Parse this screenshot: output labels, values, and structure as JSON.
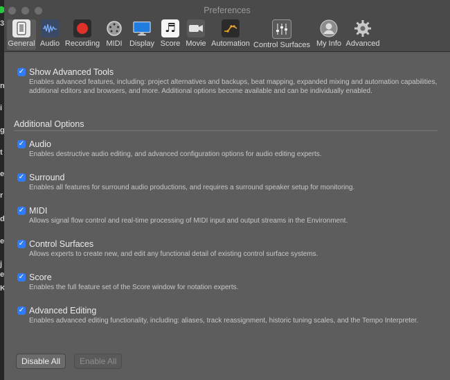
{
  "window": {
    "title": "Preferences"
  },
  "background": {
    "partial_chars": [
      "3",
      "n",
      "i",
      "g",
      "t",
      "e",
      "r",
      "d",
      "e",
      "j",
      "e",
      "K"
    ]
  },
  "toolbar": {
    "items": [
      {
        "label": "General",
        "icon": "general-icon",
        "selected": true
      },
      {
        "label": "Audio",
        "icon": "audio-waveform-icon"
      },
      {
        "label": "Recording",
        "icon": "record-icon"
      },
      {
        "label": "MIDI",
        "icon": "midi-port-icon"
      },
      {
        "label": "Display",
        "icon": "display-icon"
      },
      {
        "label": "Score",
        "icon": "score-notes-icon"
      },
      {
        "label": "Movie",
        "icon": "movie-camera-icon"
      },
      {
        "label": "Automation",
        "icon": "automation-icon"
      },
      {
        "label": "Control Surfaces",
        "icon": "control-surfaces-icon"
      },
      {
        "label": "My Info",
        "icon": "user-icon"
      },
      {
        "label": "Advanced",
        "icon": "gear-icon"
      }
    ]
  },
  "main": {
    "show_advanced": {
      "label": "Show Advanced Tools",
      "checked": true,
      "description": "Enables advanced features, including: project alternatives and backups, beat mapping, expanded mixing and automation capabilities, additional editors and browsers, and more. Additional options become available and can be individually enabled."
    },
    "additional_title": "Additional Options",
    "options": [
      {
        "label": "Audio",
        "checked": true,
        "description": "Enables destructive audio editing, and advanced configuration options for audio editing experts."
      },
      {
        "label": "Surround",
        "checked": true,
        "description": "Enables all features for surround audio productions, and requires a surround speaker setup for monitoring."
      },
      {
        "label": "MIDI",
        "checked": true,
        "description": "Allows signal flow control and real-time processing of MIDI input and output streams in the Environment."
      },
      {
        "label": "Control Surfaces",
        "checked": true,
        "description": "Allows experts to create new, and edit any functional detail of existing control surface systems."
      },
      {
        "label": "Score",
        "checked": true,
        "description": "Enables the full feature set of the Score window for notation experts."
      },
      {
        "label": "Advanced Editing",
        "checked": true,
        "description": "Enables advanced editing functionality, including: aliases, track reassignment, historic tuning scales, and the Tempo Interpreter."
      }
    ],
    "buttons": {
      "disable_all": "Disable All",
      "enable_all": "Enable All"
    }
  },
  "colors": {
    "accent": "#2f7cf6",
    "window_bg": "#5d5d5d",
    "toolbar_bg": "#4a4a4a"
  }
}
